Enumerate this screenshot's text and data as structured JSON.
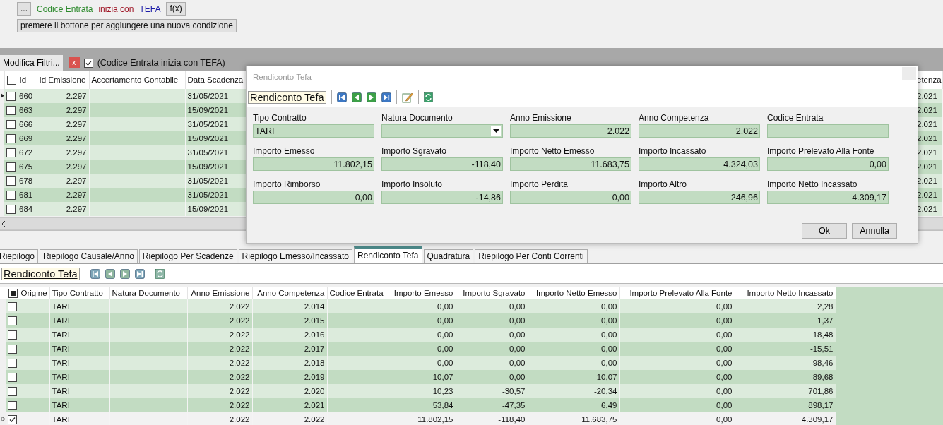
{
  "filter": {
    "more_button": "...",
    "field": "Codice Entrata",
    "operator": "inizia con",
    "value": "TEFA",
    "fx_button": "f(x)",
    "add_condition_button": "premere il bottone per aggiungere una nuova condizione"
  },
  "filter_bar": {
    "edit_button": "Modifica Filtri...",
    "clear_button": "x",
    "checked": true,
    "summary": "(Codice Entrata inizia con TEFA)"
  },
  "upper_grid": {
    "header_checked": false,
    "columns": [
      "Id",
      "Id Emissione",
      "Accertamento Contabile",
      "Data Scadenza",
      "etenza"
    ],
    "rows": [
      {
        "selected": true,
        "checked": false,
        "cells": [
          "660",
          "2.297",
          null,
          "31/05/2021",
          "2.021"
        ]
      },
      {
        "selected": false,
        "checked": false,
        "cells": [
          "663",
          "2.297",
          null,
          "15/09/2021",
          "2.021"
        ]
      },
      {
        "selected": false,
        "checked": false,
        "cells": [
          "666",
          "2.297",
          null,
          "31/05/2021",
          "2.021"
        ]
      },
      {
        "selected": false,
        "checked": false,
        "cells": [
          "669",
          "2.297",
          null,
          "15/09/2021",
          "2.021"
        ]
      },
      {
        "selected": false,
        "checked": false,
        "cells": [
          "672",
          "2.297",
          null,
          "31/05/2021",
          "2.021"
        ]
      },
      {
        "selected": false,
        "checked": false,
        "cells": [
          "675",
          "2.297",
          null,
          "15/09/2021",
          "2.021"
        ]
      },
      {
        "selected": false,
        "checked": false,
        "cells": [
          "678",
          "2.297",
          null,
          "31/05/2021",
          "2.021"
        ]
      },
      {
        "selected": false,
        "checked": false,
        "cells": [
          "681",
          "2.297",
          null,
          "31/05/2021",
          "2.021"
        ]
      },
      {
        "selected": false,
        "checked": false,
        "cells": [
          "684",
          "2.297",
          null,
          "15/09/2021",
          "2.021"
        ]
      }
    ]
  },
  "dialog": {
    "title": "Rendiconto Tefa",
    "toolbar": {
      "label": "Rendiconto Tefa",
      "disabled": false
    },
    "fields": [
      {
        "kind": "text",
        "label": "Tipo Contratto",
        "value": "TARI"
      },
      {
        "kind": "dropdown",
        "label": "Natura Documento"
      },
      {
        "kind": "number",
        "label": "Anno Emissione",
        "value": "2.022"
      },
      {
        "kind": "number",
        "label": "Anno Competenza",
        "value": "2.022"
      },
      {
        "kind": "text",
        "label": "Codice Entrata"
      },
      {
        "kind": "number",
        "label": "Importo Emesso",
        "value": "11.802,15"
      },
      {
        "kind": "number",
        "label": "Importo Sgravato",
        "value": "-118,40"
      },
      {
        "kind": "number",
        "label": "Importo Netto Emesso",
        "value": "11.683,75"
      },
      {
        "kind": "number",
        "label": "Importo Incassato",
        "value": "4.324,03"
      },
      {
        "kind": "number",
        "label": "Importo Prelevato Alla Fonte",
        "value": "0,00"
      },
      {
        "kind": "number",
        "label": "Importo Rimborso",
        "value": "0,00"
      },
      {
        "kind": "number",
        "label": "Importo Insoluto",
        "value": "-14,86"
      },
      {
        "kind": "number",
        "label": "Importo Perdita",
        "value": "0,00"
      },
      {
        "kind": "number",
        "label": "Importo Altro",
        "value": "246,96"
      },
      {
        "kind": "number",
        "label": "Importo Netto Incassato",
        "value": "4.309,17"
      }
    ],
    "buttons": [
      "Ok",
      "Annulla"
    ]
  },
  "tabs": [
    {
      "label": "Riepilogo",
      "selected": false
    },
    {
      "label": "Riepilogo Causale/Anno",
      "selected": false
    },
    {
      "label": "Riepilogo Per Scadenze",
      "selected": false
    },
    {
      "label": "Riepilogo Emesso/Incassato",
      "selected": false
    },
    {
      "label": "Rendiconto Tefa",
      "selected": true
    },
    {
      "label": "Quadratura",
      "selected": false
    },
    {
      "label": "Riepilogo Per Conti Correnti",
      "selected": false
    }
  ],
  "toolbar": {
    "label": "Rendiconto Tefa",
    "disabled": true
  },
  "lower_grid": {
    "header_partly_checked": true,
    "columns": [
      "Origine",
      "Tipo Contratto",
      "Natura Documento",
      "Anno Emissione",
      "Anno Competenza",
      "Codice Entrata",
      "Importo Emesso",
      "Importo Sgravato",
      "Importo Netto Emesso",
      "Importo Prelevato Alla Fonte",
      "Importo Netto Incassato"
    ],
    "rows": [
      {
        "selected": false,
        "checked": false,
        "cells": [
          null,
          "TARI",
          null,
          "2.022",
          "2.014",
          null,
          "0,00",
          "0,00",
          "0,00",
          "0,00",
          "2,28"
        ]
      },
      {
        "selected": false,
        "checked": false,
        "cells": [
          null,
          "TARI",
          null,
          "2.022",
          "2.015",
          null,
          "0,00",
          "0,00",
          "0,00",
          "0,00",
          "1,37"
        ]
      },
      {
        "selected": false,
        "checked": false,
        "cells": [
          null,
          "TARI",
          null,
          "2.022",
          "2.016",
          null,
          "0,00",
          "0,00",
          "0,00",
          "0,00",
          "18,48"
        ]
      },
      {
        "selected": false,
        "checked": false,
        "cells": [
          null,
          "TARI",
          null,
          "2.022",
          "2.017",
          null,
          "0,00",
          "0,00",
          "0,00",
          "0,00",
          "-15,51"
        ]
      },
      {
        "selected": false,
        "checked": false,
        "cells": [
          null,
          "TARI",
          null,
          "2.022",
          "2.018",
          null,
          "0,00",
          "0,00",
          "0,00",
          "0,00",
          "98,46"
        ]
      },
      {
        "selected": false,
        "checked": false,
        "cells": [
          null,
          "TARI",
          null,
          "2.022",
          "2.019",
          null,
          "10,07",
          "0,00",
          "10,07",
          "0,00",
          "89,68"
        ]
      },
      {
        "selected": false,
        "checked": false,
        "cells": [
          null,
          "TARI",
          null,
          "2.022",
          "2.020",
          null,
          "10,23",
          "-30,57",
          "-20,34",
          "0,00",
          "701,86"
        ]
      },
      {
        "selected": false,
        "checked": false,
        "cells": [
          null,
          "TARI",
          null,
          "2.022",
          "2.021",
          null,
          "53,84",
          "-47,35",
          "6,49",
          "0,00",
          "898,17"
        ]
      },
      {
        "selected": true,
        "checked": true,
        "cells": [
          null,
          "TARI",
          null,
          "2.022",
          "2.022",
          null,
          "11.802,15",
          "-118,40",
          "11.683,75",
          "0,00",
          "4.309,17"
        ]
      }
    ]
  }
}
